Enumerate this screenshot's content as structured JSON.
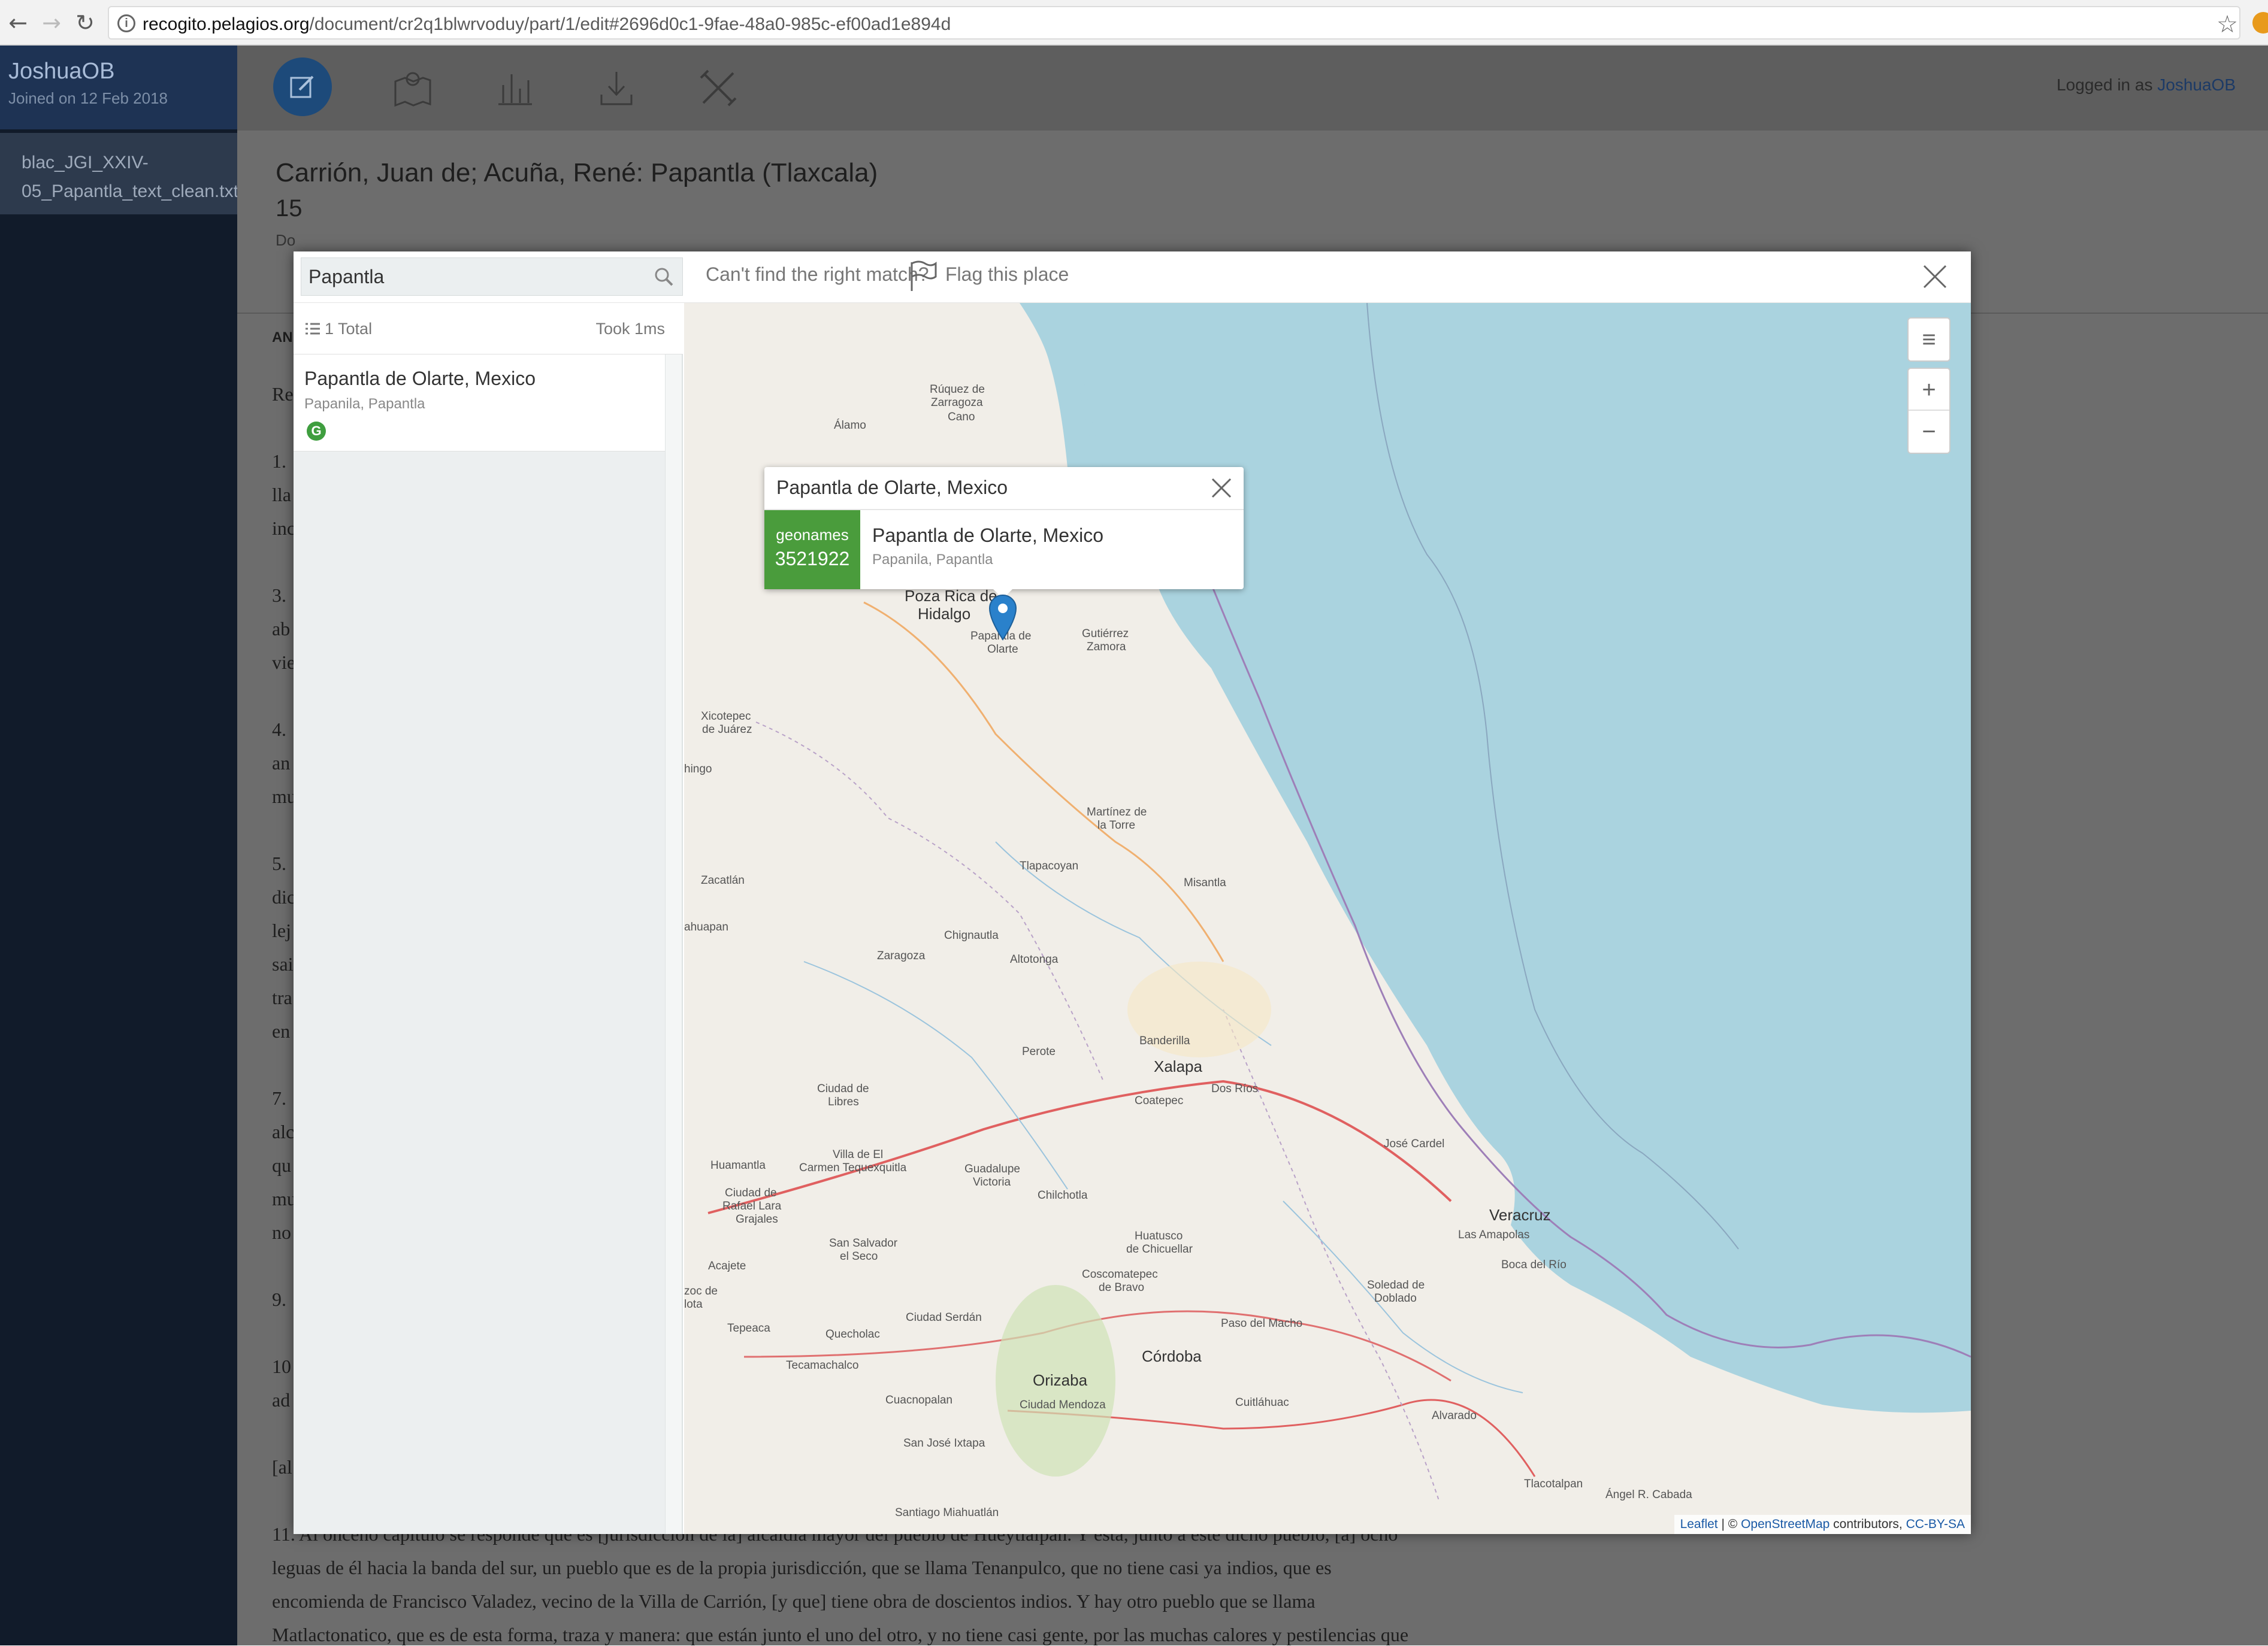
{
  "browser": {
    "url_domain": "recogito.pelagios.org",
    "url_path": "/document/cr2q1blwrvoduy/part/1/edit#2696d0c1-9fae-48a0-985c-ef00ad1e894d"
  },
  "sidebar": {
    "username": "JoshuaOB",
    "joined": "Joined on 12 Feb 2018",
    "document_file": "blac_JGI_XXIV-05_Papantla_text_clean.txt"
  },
  "header": {
    "logged_in_prefix": "Logged in as",
    "logged_in_user": "JoshuaOB",
    "doc_title": "Carrión, Juan de; Acuña, René: Papantla (Tlaxcala)",
    "doc_sub": "15",
    "doc_sub2": "Do",
    "tab_label": "AN"
  },
  "body_text": {
    "p_start": "Re",
    "p1": "1.",
    "p1b": "lla",
    "p1c": "inc",
    "p3": "3.",
    "p3b": "ab",
    "p3c": "vie",
    "p4": "4.",
    "p4b": "an",
    "p4c": "mu",
    "p5": "5.",
    "p5b": "dic",
    "p5c": "lej",
    "p5d": "sai",
    "p5e": "tra",
    "p5f": "en",
    "p7": "7.",
    "p7b": "alc",
    "p7c": "qu",
    "p7d": "mu",
    "p7e": "no",
    "p9": "9.",
    "p10": "10",
    "p10b": "ad",
    "p10c": "[al",
    "p11_l1": "11. Al onceno capítulo se responde que es [jurisdicción de la] alcaldía mayor del pueblo de Hueytlalpan. Y está, junto a este dicho pueblo, [a] ocho",
    "p11_l2": "leguas de él hacia la banda del sur, un pueblo que es de la propia jurisdicción, que se llama Tenanpulco, que no tiene casi ya indios, que es",
    "p11_l3": "encomienda de Francisco Valadez, vecino de la Villa de Carrión, [y que] tiene obra de doscientos indios. Y hay otro pueblo que se llama",
    "p11_l4": "Matlactonatico, que es de esta forma, traza y manera: que están junto el uno del otro, y no tiene casi gente, por las muchas calores y pestilencias que"
  },
  "modal": {
    "search_value": "Papantla",
    "cant_find": "Can't find the right match?",
    "flag_label": "Flag this place",
    "total": "1 Total",
    "took": "Took 1ms",
    "result": {
      "title": "Papantla de Olarte, Mexico",
      "subtitle": "Papanila, Papantla",
      "badge": "G"
    },
    "popup": {
      "title": "Papantla de Olarte, Mexico",
      "gazetteer": "geonames",
      "gazetteer_id": "3521922",
      "place_title": "Papantla de Olarte, Mexico",
      "place_sub": "Papanila, Papantla"
    },
    "map_controls": {
      "layers": "≡",
      "zoom_in": "+",
      "zoom_out": "−"
    },
    "attribution": {
      "leaflet": "Leaflet",
      "sep": " | © ",
      "osm": "OpenStreetMap",
      "contrib": " contributors, ",
      "license": "CC-BY-SA"
    },
    "map_labels": [
      "Rúquez de",
      "Zarragoza",
      "Cano",
      "Álamo",
      "Poza Rica de",
      "Hidalgo",
      "Papantla de",
      "Olarte",
      "Gutiérrez",
      "Zamora",
      "Xicotepec",
      "de Juárez",
      "hingo",
      "Martínez de",
      "la Torre",
      "Tlapacoyan",
      "Misantla",
      "Zacatlán",
      "ahuapan",
      "Chignautla",
      "Zaragoza",
      "Altotonga",
      "Perote",
      "Banderilla",
      "Xalapa",
      "Dos Ríos",
      "Coatepec",
      "Ciudad de",
      "Libres",
      "Villa de El",
      "Carmen Tequexquitla",
      "Huamantla",
      "Guadalupe",
      "Victoria",
      "Chilchotla",
      "José Cardel",
      "Veracruz",
      "Las Amapolas",
      "Boca del Río",
      "Ciudad de",
      "Rafael Lara",
      "Grajales",
      "San Salvador",
      "el Seco",
      "Huatusco",
      "de Chicuellar",
      "Acajete",
      "Coscomatepec",
      "de Bravo",
      "Soledad de",
      "Doblado",
      "zoc de",
      "lota",
      "Ciudad Serdán",
      "Tepeaca",
      "Quecholac",
      "Paso del Macho",
      "Tecamachalco",
      "Córdoba",
      "Orizaba",
      "Cuacnopalan",
      "Ciudad Mendoza",
      "Cuitláhuac",
      "Alvarado",
      "San José Ixtapa",
      "Tlacotalpan",
      "Ángel R. Cabada",
      "Santiago Miahuatlán"
    ]
  }
}
